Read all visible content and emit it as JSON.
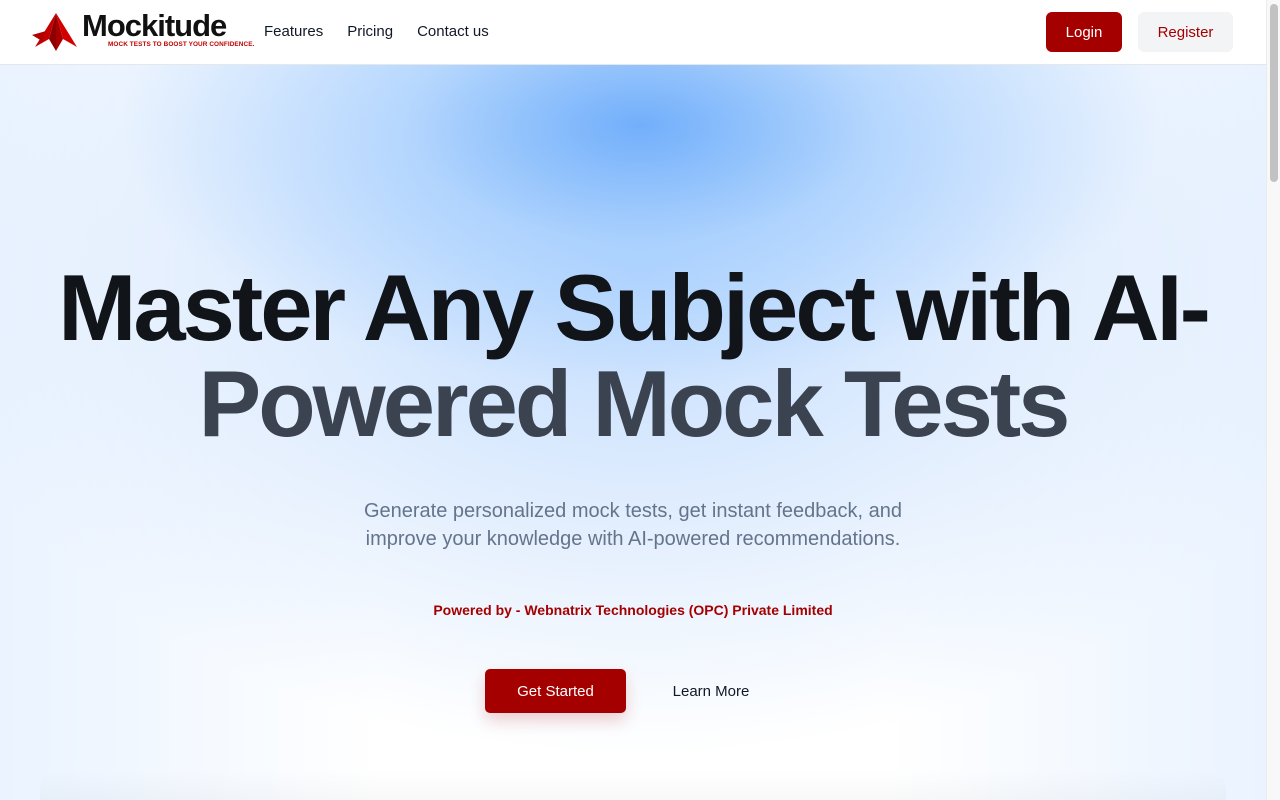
{
  "brand": {
    "name": "Mockitude",
    "tagline": "MOCK TESTS TO BOOST YOUR CONFIDENCE.",
    "logo_icon": "paper-plane-icon",
    "color": "#a50000"
  },
  "nav": {
    "items": [
      {
        "label": "Features"
      },
      {
        "label": "Pricing"
      },
      {
        "label": "Contact us"
      }
    ]
  },
  "auth": {
    "login_label": "Login",
    "register_label": "Register"
  },
  "hero": {
    "title_line1": "Master Any Subject with AI-",
    "title_line2": "Powered Mock Tests",
    "subtitle": "Generate personalized mock tests, get instant feedback, and improve your knowledge with AI-powered recommendations.",
    "powered_by": "Powered by - Webnatrix Technologies (OPC) Private Limited",
    "cta_primary": "Get Started",
    "cta_secondary": "Learn More"
  }
}
